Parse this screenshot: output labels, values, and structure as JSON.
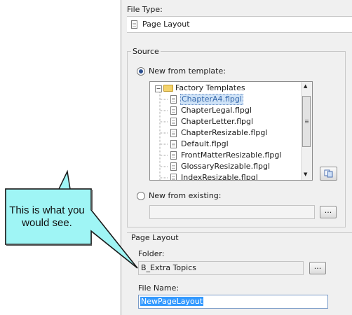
{
  "file_type": {
    "label": "File Type:",
    "value": "Page Layout",
    "icon": "page-layout-icon"
  },
  "source": {
    "legend": "Source",
    "new_from_template_label": "New from template:",
    "new_from_template_selected": true,
    "tree": {
      "folder_label": "Factory Templates",
      "expanded": true,
      "files": [
        "ChapterA4.flpgl",
        "ChapterLegal.flpgl",
        "ChapterLetter.flpgl",
        "ChapterResizable.flpgl",
        "Default.flpgl",
        "FrontMatterResizable.flpgl",
        "GlossaryResizable.flpgl",
        "IndexResizable.flpgl"
      ],
      "selected_file": "ChapterA4.flpgl",
      "expander_glyph": "−"
    },
    "new_from_existing_label": "New from existing:",
    "new_from_existing_selected": false,
    "existing_path": "",
    "browse_label": "..."
  },
  "page_layout": {
    "legend": "Page Layout",
    "folder_label": "Folder:",
    "folder_value": "B_Extra Topics",
    "browse_label": "...",
    "file_name_label": "File Name:",
    "file_name_value": "NewPageLayout"
  },
  "callout": {
    "text": "This is what you would see.",
    "fill": "#9ff5f5"
  },
  "colors": {
    "selection": "#cfe3f7",
    "panel": "#f0f0f0",
    "radio_dot": "#2b4f8f"
  }
}
